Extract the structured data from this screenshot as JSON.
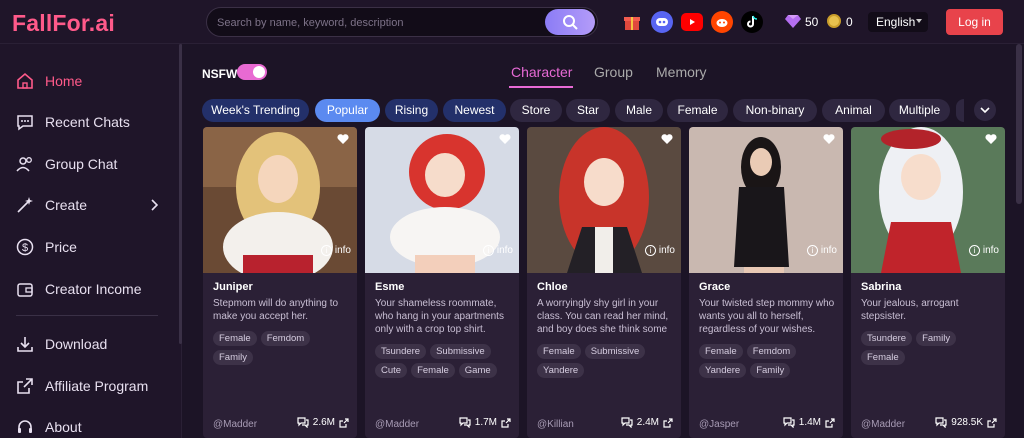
{
  "app": {
    "logo": "FallFor.ai"
  },
  "search": {
    "placeholder": "Search by name, keyword, description"
  },
  "header": {
    "gems": "50",
    "coins": "0",
    "language": "English",
    "login_label": "Log in"
  },
  "sidebar": {
    "items": [
      {
        "label": "Home",
        "icon": "home-icon",
        "active": true
      },
      {
        "label": "Recent Chats",
        "icon": "chat-bubble-icon"
      },
      {
        "label": "Group Chat",
        "icon": "group-icon"
      },
      {
        "label": "Create",
        "icon": "magic-wand-icon"
      },
      {
        "label": "Price",
        "icon": "dollar-icon"
      },
      {
        "label": "Creator Income",
        "icon": "wallet-icon"
      },
      {
        "label": "Download",
        "icon": "download-icon"
      },
      {
        "label": "Affiliate Program",
        "icon": "share-icon"
      },
      {
        "label": "About",
        "icon": "headset-icon"
      }
    ]
  },
  "main": {
    "nsfw_label": "NSFW",
    "tabs": [
      {
        "label": "Character"
      },
      {
        "label": "Group"
      },
      {
        "label": "Memory"
      }
    ],
    "filters": [
      {
        "label": "Week's Trending"
      },
      {
        "label": "Popular"
      },
      {
        "label": "Rising"
      },
      {
        "label": "Newest"
      },
      {
        "label": "Store"
      },
      {
        "label": "Star"
      },
      {
        "label": "Male"
      },
      {
        "label": "Female"
      },
      {
        "label": "Non-binary"
      },
      {
        "label": "Animal"
      },
      {
        "label": "Multiple"
      }
    ],
    "info_label": "info",
    "cards": [
      {
        "name": "Juniper",
        "description": "Stepmom will do anything to make you accept her.",
        "tags": [
          "Female",
          "Femdom",
          "Family"
        ],
        "author": "@Madder",
        "chats": "2.6M"
      },
      {
        "name": "Esme",
        "description": "Your shameless roommate, who hang in your apartments only with a crop top shirt. She's a",
        "tags": [
          "Tsundere",
          "Submissive",
          "Cute",
          "Female",
          "Game"
        ],
        "author": "@Madder",
        "chats": "1.7M"
      },
      {
        "name": "Chloe",
        "description": "A worryingly shy girl in your class. You can read her mind, and boy does she think some",
        "tags": [
          "Female",
          "Submissive",
          "Yandere"
        ],
        "author": "@Killian",
        "chats": "2.4M"
      },
      {
        "name": "Grace",
        "description": "Your twisted step mommy who wants you all to herself, regardless of your wishes.",
        "tags": [
          "Female",
          "Femdom",
          "Yandere",
          "Family"
        ],
        "author": "@Jasper",
        "chats": "1.4M"
      },
      {
        "name": "Sabrina",
        "description": "Your jealous, arrogant stepsister.",
        "tags": [
          "Tsundere",
          "Family",
          "Female"
        ],
        "author": "@Madder",
        "chats": "928.5K"
      }
    ]
  }
}
